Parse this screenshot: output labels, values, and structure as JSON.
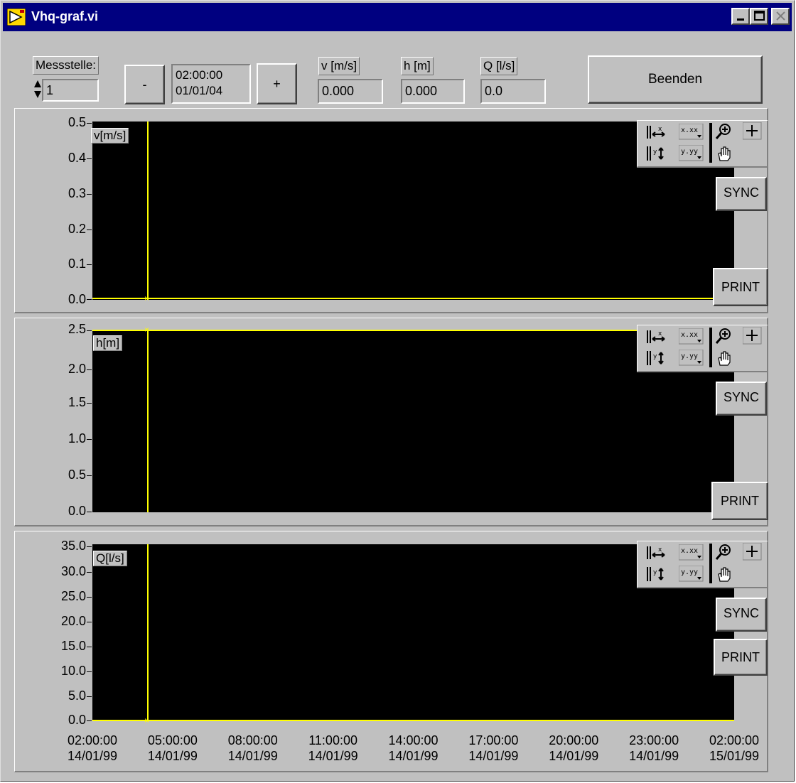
{
  "window": {
    "title": "Vhq-graf.vi"
  },
  "controls": {
    "messstelle": {
      "label": "Messstelle:",
      "value": "1"
    },
    "prev_button": "-",
    "next_button": "+",
    "datetime_time": "02:00:00",
    "datetime_date": "01/01/04",
    "v": {
      "label": "v [m/s]",
      "value": "0.000"
    },
    "h": {
      "label": "h [m]",
      "value": "0.000"
    },
    "q": {
      "label": "Q [l/s]",
      "value": "0.0"
    },
    "exit_button": "Beenden"
  },
  "graphs": {
    "sync_label": "SYNC",
    "print_label": "PRINT",
    "v": {
      "trace_label": "v[m/s]",
      "yticks": [
        "0.5",
        "0.4",
        "0.3",
        "0.2",
        "0.1",
        "0.0"
      ]
    },
    "h": {
      "trace_label": "h[m]",
      "yticks": [
        "2.5",
        "2.0",
        "1.5",
        "1.0",
        "0.5",
        "0.0"
      ]
    },
    "q": {
      "trace_label": "Q[l/s]",
      "yticks": [
        "35.0",
        "30.0",
        "25.0",
        "20.0",
        "15.0",
        "10.0",
        "5.0",
        "0.0"
      ]
    },
    "palette_icons": [
      "x-scale-lock-icon",
      "x-format-icon",
      "zoom-icon",
      "crosshair-icon",
      "y-scale-lock-icon",
      "y-format-icon",
      "pan-hand-icon"
    ]
  },
  "xaxis": {
    "ticks": [
      {
        "time": "02:00:00",
        "date": "14/01/99"
      },
      {
        "time": "05:00:00",
        "date": "14/01/99"
      },
      {
        "time": "08:00:00",
        "date": "14/01/99"
      },
      {
        "time": "11:00:00",
        "date": "14/01/99"
      },
      {
        "time": "14:00:00",
        "date": "14/01/99"
      },
      {
        "time": "17:00:00",
        "date": "14/01/99"
      },
      {
        "time": "20:00:00",
        "date": "14/01/99"
      },
      {
        "time": "23:00:00",
        "date": "14/01/99"
      },
      {
        "time": "02:00:00",
        "date": "15/01/99"
      }
    ]
  },
  "colors": {
    "trace": "#ffff00",
    "plot_bg": "#000000",
    "panel_bg": "#c0c0c0",
    "titlebar": "#000080"
  }
}
